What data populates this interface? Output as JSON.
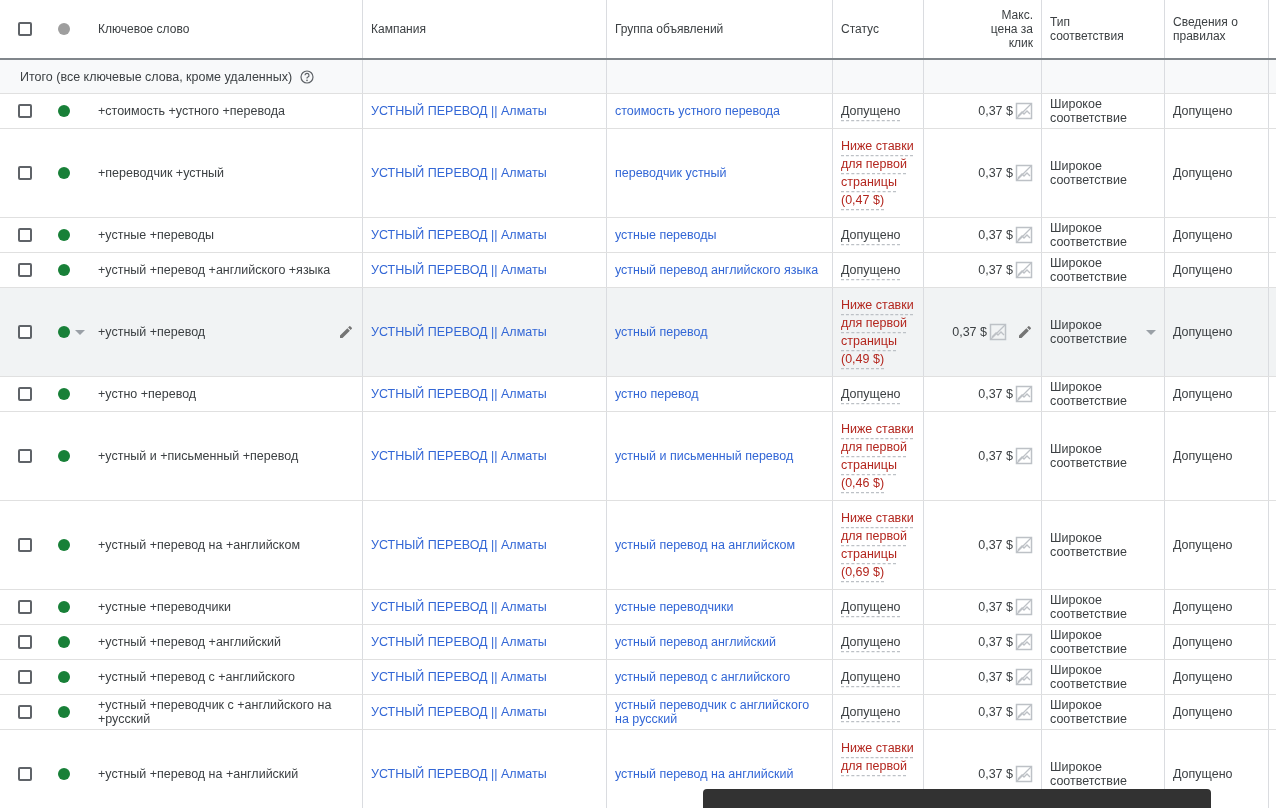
{
  "header": {
    "select_all_checked": false,
    "columns": [
      "Ключевое слово",
      "Кампания",
      "Группа объявлений",
      "Статус",
      "Макс. цена за клик",
      "Тип соответствия",
      "Сведения о правилах"
    ]
  },
  "summary": {
    "label": "Итого (все ключевые слова, кроме удаленных)"
  },
  "rows": [
    {
      "keyword": "+стоимость +устного +перевода",
      "campaign": "УСТНЫЙ ПЕРЕВОД || Алматы",
      "ad_group": "стоимость устного перевода",
      "status": "Допущено",
      "kind": "ok",
      "bid": "0,37 $",
      "match_type": "Широкое соответствие",
      "rules": "Допущено",
      "checked": false,
      "hovered": false
    },
    {
      "keyword": "+переводчик +устный",
      "campaign": "УСТНЫЙ ПЕРЕВОД || Алматы",
      "ad_group": "переводчик устный",
      "status": "Ниже ставки для первой страницы (0,47 $)",
      "kind": "low",
      "bid": "0,37 $",
      "match_type": "Широкое соответствие",
      "rules": "Допущено",
      "checked": false,
      "hovered": false
    },
    {
      "keyword": "+устные +переводы",
      "campaign": "УСТНЫЙ ПЕРЕВОД || Алматы",
      "ad_group": "устные переводы",
      "status": "Допущено",
      "kind": "ok",
      "bid": "0,37 $",
      "match_type": "Широкое соответствие",
      "rules": "Допущено",
      "checked": false,
      "hovered": false
    },
    {
      "keyword": "+устный +перевод +английского +языка",
      "campaign": "УСТНЫЙ ПЕРЕВОД || Алматы",
      "ad_group": "устный перевод английского языка",
      "status": "Допущено",
      "kind": "ok",
      "bid": "0,37 $",
      "match_type": "Широкое соответствие",
      "rules": "Допущено",
      "checked": false,
      "hovered": false
    },
    {
      "keyword": "+устный +перевод",
      "campaign": "УСТНЫЙ ПЕРЕВОД || Алматы",
      "ad_group": "устный перевод",
      "status": "Ниже ставки для первой страницы (0,49 $)",
      "kind": "low",
      "bid": "0,37 $",
      "match_type": "Широкое соответствие",
      "rules": "Допущено",
      "checked": false,
      "hovered": true
    },
    {
      "keyword": "+устно +перевод",
      "campaign": "УСТНЫЙ ПЕРЕВОД || Алматы",
      "ad_group": "устно перевод",
      "status": "Допущено",
      "kind": "ok",
      "bid": "0,37 $",
      "match_type": "Широкое соответствие",
      "rules": "Допущено",
      "checked": false,
      "hovered": false
    },
    {
      "keyword": "+устный и +письменный +перевод",
      "campaign": "УСТНЫЙ ПЕРЕВОД || Алматы",
      "ad_group": "устный и письменный перевод",
      "status": "Ниже ставки для первой страницы (0,46 $)",
      "kind": "low",
      "bid": "0,37 $",
      "match_type": "Широкое соответствие",
      "rules": "Допущено",
      "checked": false,
      "hovered": false
    },
    {
      "keyword": "+устный +перевод на +английском",
      "campaign": "УСТНЫЙ ПЕРЕВОД || Алматы",
      "ad_group": "устный перевод на английском",
      "status": "Ниже ставки для первой страницы (0,69 $)",
      "kind": "low",
      "bid": "0,37 $",
      "match_type": "Широкое соответствие",
      "rules": "Допущено",
      "checked": false,
      "hovered": false
    },
    {
      "keyword": "+устные +переводчики",
      "campaign": "УСТНЫЙ ПЕРЕВОД || Алматы",
      "ad_group": "устные переводчики",
      "status": "Допущено",
      "kind": "ok",
      "bid": "0,37 $",
      "match_type": "Широкое соответствие",
      "rules": "Допущено",
      "checked": false,
      "hovered": false
    },
    {
      "keyword": "+устный +перевод +английский",
      "campaign": "УСТНЫЙ ПЕРЕВОД || Алматы",
      "ad_group": "устный перевод английский",
      "status": "Допущено",
      "kind": "ok",
      "bid": "0,37 $",
      "match_type": "Широкое соответствие",
      "rules": "Допущено",
      "checked": false,
      "hovered": false
    },
    {
      "keyword": "+устный +перевод с +английского",
      "campaign": "УСТНЫЙ ПЕРЕВОД || Алматы",
      "ad_group": "устный перевод с английского",
      "status": "Допущено",
      "kind": "ok",
      "bid": "0,37 $",
      "match_type": "Широкое соответствие",
      "rules": "Допущено",
      "checked": false,
      "hovered": false
    },
    {
      "keyword": "+устный +переводчик с +английского на +русский",
      "campaign": "УСТНЫЙ ПЕРЕВОД || Алматы",
      "ad_group": "устный переводчик с английского на русский",
      "status": "Допущено",
      "kind": "ok",
      "bid": "0,37 $",
      "match_type": "Широкое соответствие",
      "rules": "Допущено",
      "checked": false,
      "hovered": false
    },
    {
      "keyword": "+устный +перевод на +английский",
      "campaign": "УСТНЫЙ ПЕРЕВОД || Алматы",
      "ad_group": "устный перевод на английский",
      "status": "Ниже ставки для первой",
      "kind": "low",
      "bid": "0,37 $",
      "match_type": "Широкое соответствие",
      "rules": "Допущено",
      "checked": false,
      "hovered": false
    }
  ]
}
